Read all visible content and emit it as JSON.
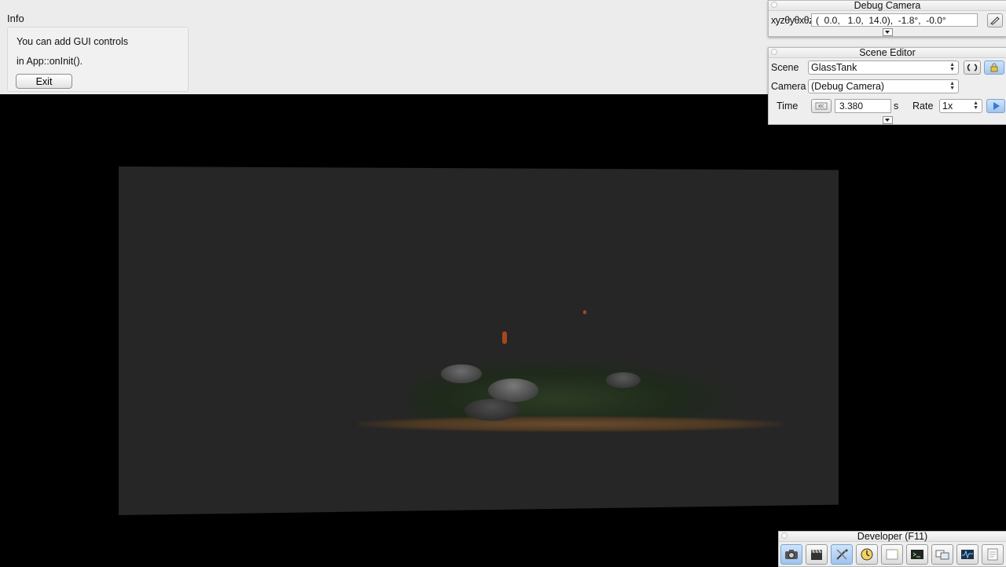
{
  "info": {
    "title": "Info",
    "line1": "You can add GUI controls",
    "line2": "in App::onInit().",
    "exit_label": "Exit"
  },
  "debug_camera": {
    "title": "Debug Camera",
    "xyz_label": "xyzθyθxθz",
    "coordinates": "(  0.0,   1.0,  14.0),  -1.8°,  -0.0°"
  },
  "scene_editor": {
    "title": "Scene Editor",
    "scene_label": "Scene",
    "scene_value": "GlassTank",
    "camera_label": "Camera",
    "camera_value": "(Debug Camera)",
    "time_label": "Time",
    "time_value": "3.380",
    "time_unit": "s",
    "rate_label": "Rate",
    "rate_value": "1x"
  },
  "developer": {
    "title": "Developer (F11)",
    "tools": [
      "camera-icon",
      "clapperboard-icon",
      "wrench-icon",
      "clock-icon",
      "note-icon",
      "terminal-icon",
      "window-icon",
      "profiler-icon",
      "document-icon"
    ]
  },
  "colors": {
    "viewport_bg": "#262626",
    "panel_bg": "#eeeeee",
    "accent_blue": "#9ec4ef"
  }
}
